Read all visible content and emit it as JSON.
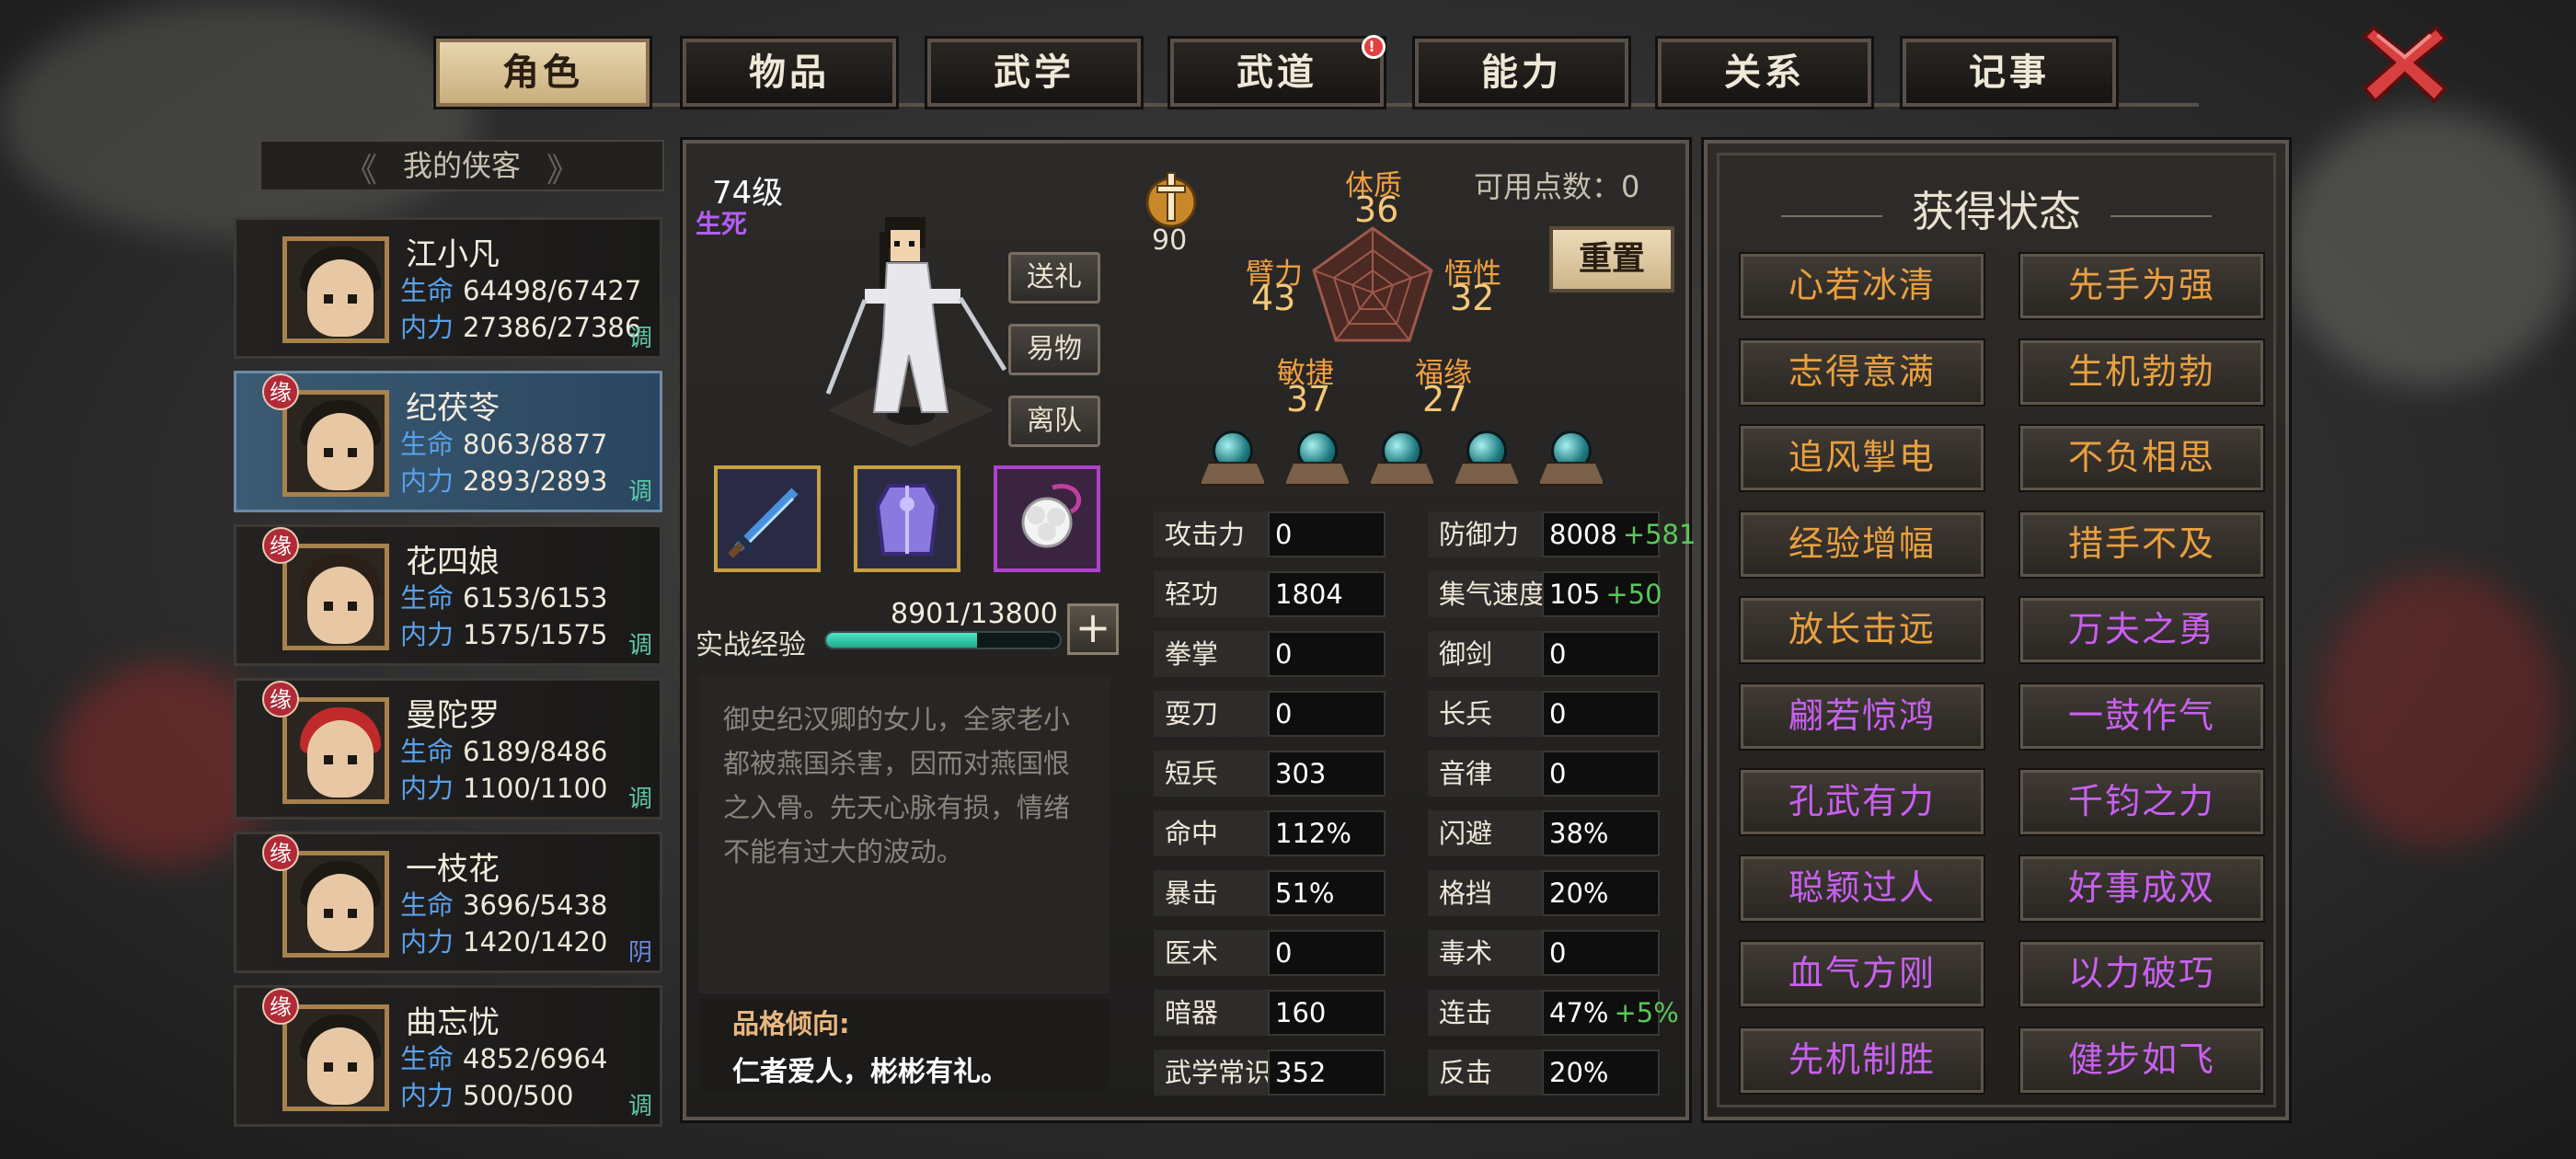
{
  "tabs": [
    {
      "label": "角色",
      "active": true
    },
    {
      "label": "物品"
    },
    {
      "label": "武学"
    },
    {
      "label": "武道",
      "badge": "!"
    },
    {
      "label": "能力"
    },
    {
      "label": "关系"
    },
    {
      "label": "记事"
    }
  ],
  "roster": {
    "title": "我的侠客",
    "heroes": [
      {
        "name": "江小凡",
        "hp_label": "生命",
        "hp": "64498/67427",
        "mp_label": "内力",
        "mp": "27386/27386",
        "tag": "调",
        "badge": ""
      },
      {
        "name": "纪茯苓",
        "hp_label": "生命",
        "hp": "8063/8877",
        "mp_label": "内力",
        "mp": "2893/2893",
        "tag": "调",
        "badge": "缘",
        "selected": true
      },
      {
        "name": "花四娘",
        "hp_label": "生命",
        "hp": "6153/6153",
        "mp_label": "内力",
        "mp": "1575/1575",
        "tag": "调",
        "badge": "缘"
      },
      {
        "name": "曼陀罗",
        "hp_label": "生命",
        "hp": "6189/8486",
        "mp_label": "内力",
        "mp": "1100/1100",
        "tag": "调",
        "badge": "缘"
      },
      {
        "name": "一枝花",
        "hp_label": "生命",
        "hp": "3696/5438",
        "mp_label": "内力",
        "mp": "1420/1420",
        "tag": "阴",
        "badge": "缘"
      },
      {
        "name": "曲忘忧",
        "hp_label": "生命",
        "hp": "4852/6964",
        "mp_label": "内力",
        "mp": "500/500",
        "tag": "调",
        "badge": "缘"
      }
    ]
  },
  "character": {
    "level": "74级",
    "realm": "生死",
    "buttons": {
      "gift": "送礼",
      "trade": "易物",
      "leave": "离队"
    },
    "power": "90",
    "exp_label": "实战经验",
    "exp_value": "8901/13800",
    "exp_fraction": 0.645,
    "bio": "御史纪汉卿的女儿，全家老小都被燕国杀害，因而对燕国恨之入骨。先天心脉有损，情绪不能有过大的波动。",
    "trait_title": "品格倾向:",
    "trait_text": "仁者爱人，彬彬有礼。"
  },
  "attributes": {
    "points_label": "可用点数：0",
    "reset_label": "重置",
    "tizhi": {
      "label": "体质",
      "value": "36"
    },
    "bili": {
      "label": "臂力",
      "value": "43"
    },
    "wuxing": {
      "label": "悟性",
      "value": "32"
    },
    "minjie": {
      "label": "敏捷",
      "value": "37"
    },
    "fuyuan": {
      "label": "福缘",
      "value": "27"
    }
  },
  "stats_left": [
    {
      "label": "攻击力",
      "value": "0"
    },
    {
      "label": "轻功",
      "value": "1804"
    },
    {
      "label": "拳掌",
      "value": "0"
    },
    {
      "label": "耍刀",
      "value": "0"
    },
    {
      "label": "短兵",
      "value": "303"
    },
    {
      "label": "命中",
      "value": "112%"
    },
    {
      "label": "暴击",
      "value": "51%"
    },
    {
      "label": "医术",
      "value": "0"
    },
    {
      "label": "暗器",
      "value": "160"
    },
    {
      "label": "武学常识",
      "value": "352"
    }
  ],
  "stats_right": [
    {
      "label": "防御力",
      "value": "8008",
      "bonus": "+581"
    },
    {
      "label": "集气速度",
      "value": "105",
      "bonus": "+50"
    },
    {
      "label": "御剑",
      "value": "0",
      "bonus": ""
    },
    {
      "label": "长兵",
      "value": "0",
      "bonus": ""
    },
    {
      "label": "音律",
      "value": "0",
      "bonus": ""
    },
    {
      "label": "闪避",
      "value": "38%",
      "bonus": ""
    },
    {
      "label": "格挡",
      "value": "20%",
      "bonus": ""
    },
    {
      "label": "毒术",
      "value": "0",
      "bonus": ""
    },
    {
      "label": "连击",
      "value": "47%",
      "bonus": "+5%"
    },
    {
      "label": "反击",
      "value": "20%",
      "bonus": ""
    }
  ],
  "status": {
    "title": "获得状态",
    "buffs": [
      {
        "label": "心若冰清",
        "color": "gold"
      },
      {
        "label": "先手为强",
        "color": "gold"
      },
      {
        "label": "志得意满",
        "color": "gold"
      },
      {
        "label": "生机勃勃",
        "color": "gold"
      },
      {
        "label": "追风掣电",
        "color": "gold"
      },
      {
        "label": "不负相思",
        "color": "gold"
      },
      {
        "label": "经验增幅",
        "color": "gold"
      },
      {
        "label": "措手不及",
        "color": "gold"
      },
      {
        "label": "放长击远",
        "color": "gold"
      },
      {
        "label": "万夫之勇",
        "color": "purple"
      },
      {
        "label": "翩若惊鸿",
        "color": "purple"
      },
      {
        "label": "一鼓作气",
        "color": "purple"
      },
      {
        "label": "孔武有力",
        "color": "purple"
      },
      {
        "label": "千钧之力",
        "color": "purple"
      },
      {
        "label": "聪颖过人",
        "color": "purple"
      },
      {
        "label": "好事成双",
        "color": "purple"
      },
      {
        "label": "血气方刚",
        "color": "purple"
      },
      {
        "label": "以力破巧",
        "color": "purple"
      },
      {
        "label": "先机制胜",
        "color": "purple"
      },
      {
        "label": "健步如飞",
        "color": "purple"
      }
    ]
  },
  "colors": {
    "gold": "#e8a040",
    "purple": "#c860f0",
    "accent_teal": "#4ae8c8",
    "bonus_green": "#5ac85a"
  }
}
